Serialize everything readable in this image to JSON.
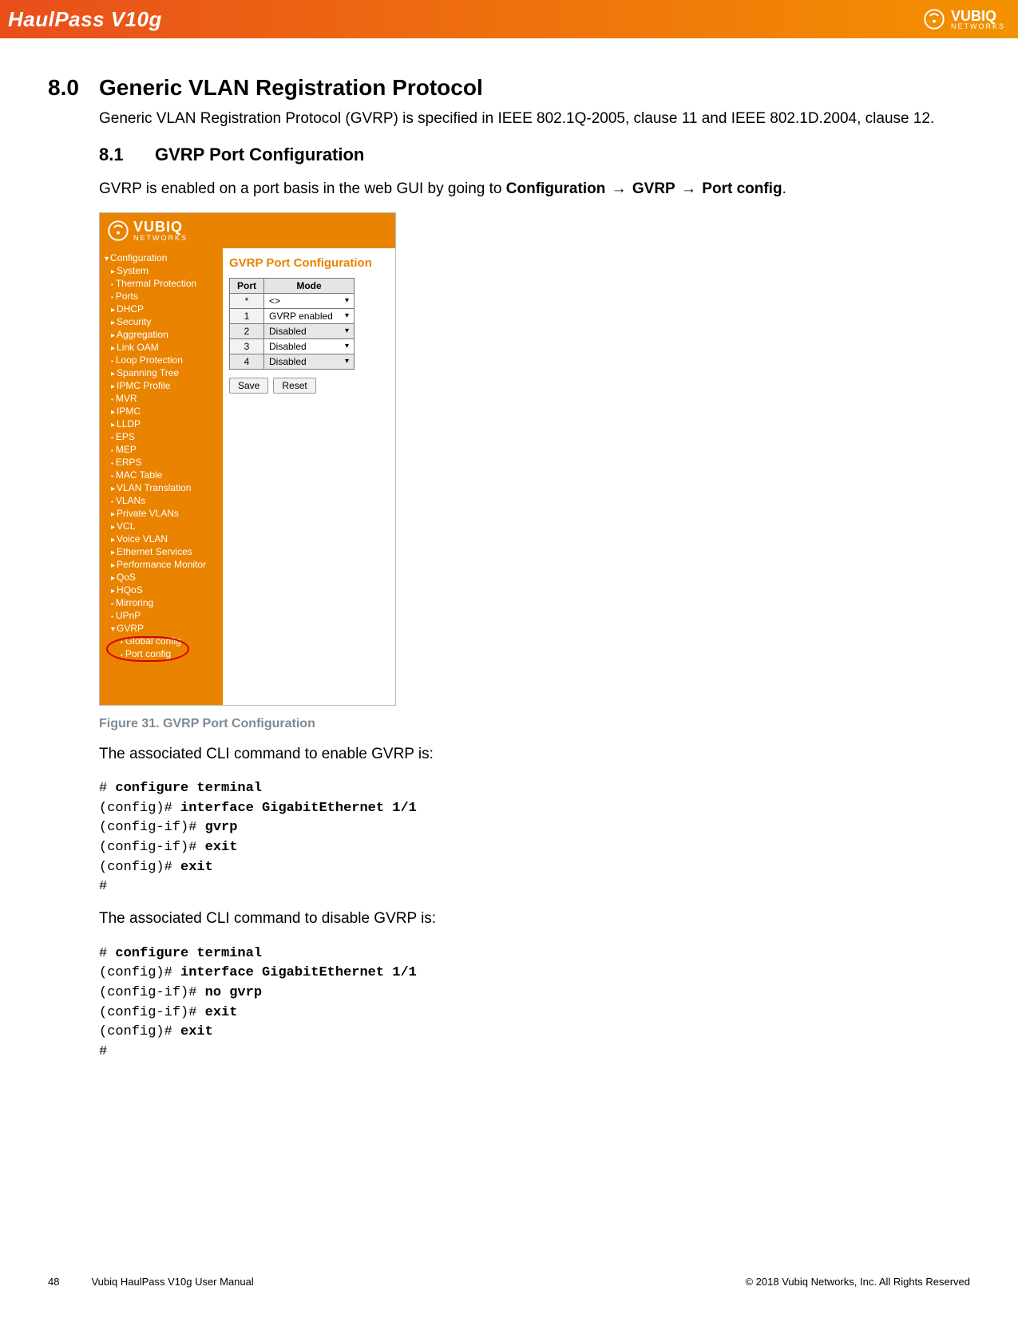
{
  "banner": {
    "product": "HaulPass V10g",
    "brand_main": "VUBIQ",
    "brand_sub": "NETWORKS"
  },
  "h1": {
    "num": "8.0",
    "title": "Generic VLAN Registration Protocol"
  },
  "intro": "Generic VLAN Registration Protocol (GVRP) is specified in IEEE 802.1Q-2005, clause 11 and IEEE 802.1D.2004, clause 12.",
  "h2": {
    "num": "8.1",
    "title": "GVRP Port Configuration"
  },
  "bc": {
    "lead": "GVRP is enabled on a port basis in the web GUI by going to ",
    "b1": "Configuration",
    "b2": "GVRP",
    "b3": "Port config",
    "tail": "."
  },
  "nav": [
    {
      "lvl": 1,
      "style": "dn",
      "label": "Configuration"
    },
    {
      "lvl": 2,
      "style": "tri",
      "label": "System"
    },
    {
      "lvl": 2,
      "style": "dot",
      "label": "Thermal Protection"
    },
    {
      "lvl": 2,
      "style": "dot",
      "label": "Ports"
    },
    {
      "lvl": 2,
      "style": "tri",
      "label": "DHCP"
    },
    {
      "lvl": 2,
      "style": "tri",
      "label": "Security"
    },
    {
      "lvl": 2,
      "style": "tri",
      "label": "Aggregation"
    },
    {
      "lvl": 2,
      "style": "tri",
      "label": "Link OAM"
    },
    {
      "lvl": 2,
      "style": "dot",
      "label": "Loop Protection"
    },
    {
      "lvl": 2,
      "style": "tri",
      "label": "Spanning Tree"
    },
    {
      "lvl": 2,
      "style": "tri",
      "label": "IPMC Profile"
    },
    {
      "lvl": 2,
      "style": "dot",
      "label": "MVR"
    },
    {
      "lvl": 2,
      "style": "tri",
      "label": "IPMC"
    },
    {
      "lvl": 2,
      "style": "tri",
      "label": "LLDP"
    },
    {
      "lvl": 2,
      "style": "dot",
      "label": "EPS"
    },
    {
      "lvl": 2,
      "style": "dot",
      "label": "MEP"
    },
    {
      "lvl": 2,
      "style": "dot",
      "label": "ERPS"
    },
    {
      "lvl": 2,
      "style": "dot",
      "label": "MAC Table"
    },
    {
      "lvl": 2,
      "style": "tri",
      "label": "VLAN Translation"
    },
    {
      "lvl": 2,
      "style": "dot",
      "label": "VLANs"
    },
    {
      "lvl": 2,
      "style": "tri",
      "label": "Private VLANs"
    },
    {
      "lvl": 2,
      "style": "tri",
      "label": "VCL"
    },
    {
      "lvl": 2,
      "style": "tri",
      "label": "Voice VLAN"
    },
    {
      "lvl": 2,
      "style": "tri",
      "label": "Ethernet Services"
    },
    {
      "lvl": 2,
      "style": "tri",
      "label": "Performance Monitor"
    },
    {
      "lvl": 2,
      "style": "tri",
      "label": "QoS"
    },
    {
      "lvl": 2,
      "style": "tri",
      "label": "HQoS"
    },
    {
      "lvl": 2,
      "style": "dot",
      "label": "Mirroring"
    },
    {
      "lvl": 2,
      "style": "dot",
      "label": "UPnP"
    },
    {
      "lvl": 2,
      "style": "dn",
      "label": "GVRP"
    },
    {
      "lvl": 3,
      "style": "dot",
      "label": "Global config"
    },
    {
      "lvl": 3,
      "style": "dot",
      "label": "Port config",
      "circle": true
    }
  ],
  "panel": {
    "title": "GVRP Port Configuration",
    "th_port": "Port",
    "th_mode": "Mode",
    "rows": [
      {
        "port": "*",
        "mode": "<>",
        "alt": false
      },
      {
        "port": "1",
        "mode": "GVRP enabled",
        "alt": false
      },
      {
        "port": "2",
        "mode": "Disabled",
        "alt": true
      },
      {
        "port": "3",
        "mode": "Disabled",
        "alt": false
      },
      {
        "port": "4",
        "mode": "Disabled",
        "alt": true
      }
    ],
    "save": "Save",
    "reset": "Reset"
  },
  "figcap": "Figure 31. GVRP Port Configuration",
  "p_enable": "The associated CLI command to enable GVRP is:",
  "cli_enable": [
    {
      "p": "# ",
      "b": "configure terminal"
    },
    {
      "p": "(config)# ",
      "b": "interface GigabitEthernet 1/1"
    },
    {
      "p": "(config-if)# ",
      "b": "gvrp"
    },
    {
      "p": "(config-if)# ",
      "b": "exit"
    },
    {
      "p": "(config)# ",
      "b": "exit"
    },
    {
      "p": "#",
      "b": ""
    }
  ],
  "p_disable": "The associated CLI command to disable GVRP is:",
  "cli_disable": [
    {
      "p": "# ",
      "b": "configure terminal"
    },
    {
      "p": "(config)# ",
      "b": "interface GigabitEthernet 1/1"
    },
    {
      "p": "(config-if)# ",
      "b": "no gvrp"
    },
    {
      "p": "(config-if)# ",
      "b": "exit"
    },
    {
      "p": "(config)# ",
      "b": "exit"
    },
    {
      "p": "#",
      "b": ""
    }
  ],
  "footer": {
    "page": "48",
    "manual": "Vubiq HaulPass V10g User Manual",
    "copy": "© 2018 Vubiq Networks, Inc. All Rights Reserved"
  }
}
